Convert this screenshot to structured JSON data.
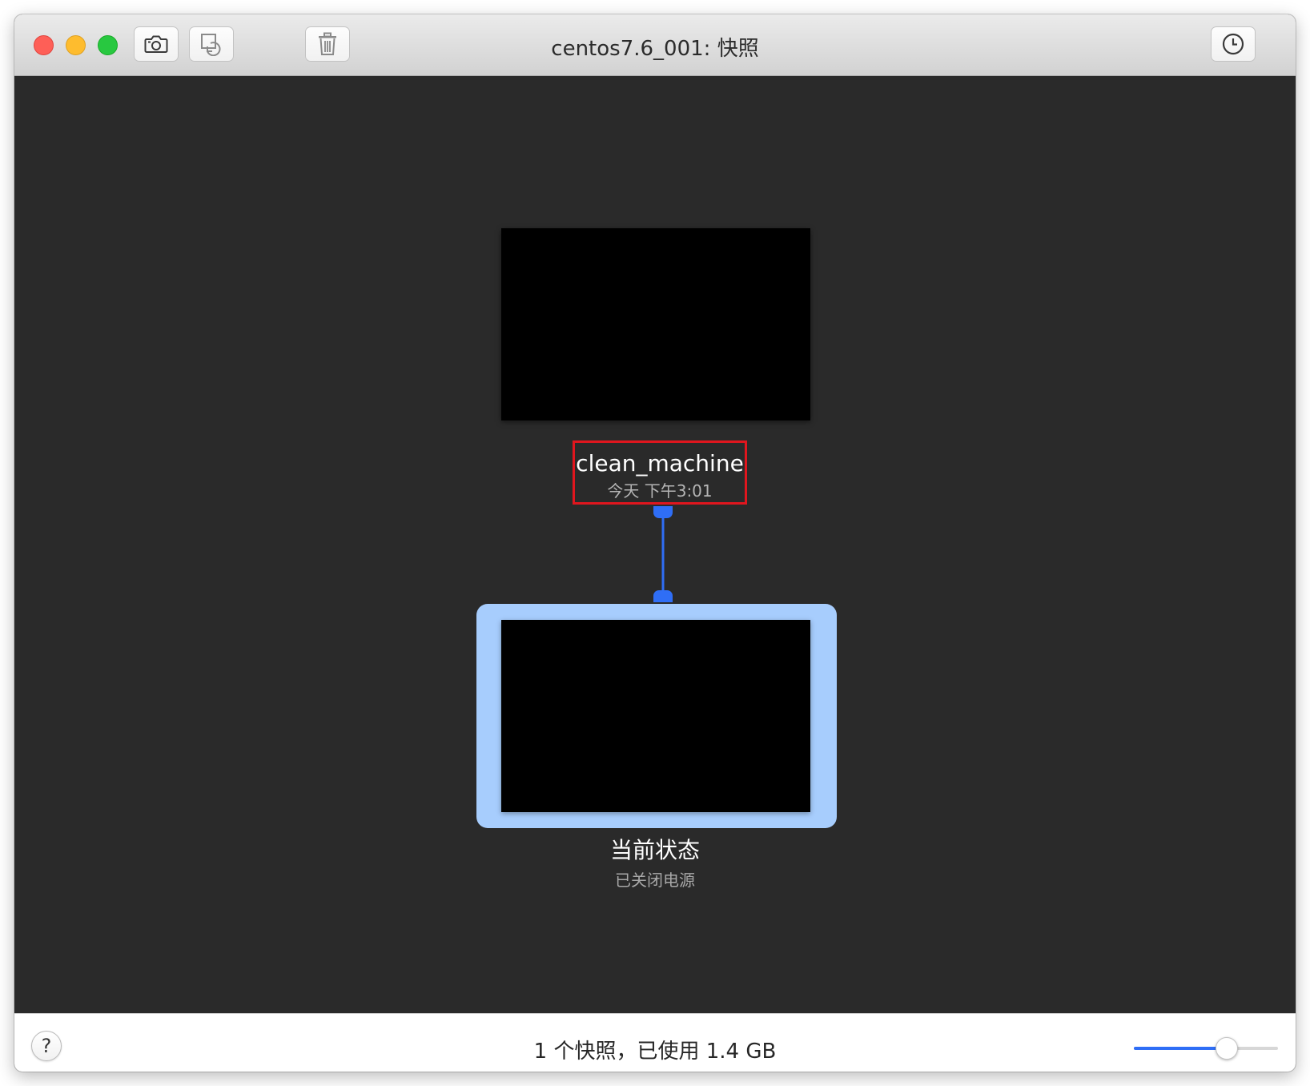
{
  "window": {
    "title": "centos7.6_001: 快照"
  },
  "toolbar": {
    "take_snapshot_icon": "camera-icon",
    "restore_snapshot_icon": "restore-icon",
    "delete_snapshot_icon": "trash-icon",
    "history_icon": "clock-icon"
  },
  "snapshot": {
    "name": "clean_machine",
    "time": "今天 下午3:01"
  },
  "current_state": {
    "name": "当前状态",
    "status": "已关闭电源"
  },
  "footer": {
    "help_label": "?",
    "summary": "1 个快照，已使用 1.4 GB",
    "zoom_fraction": 0.67
  },
  "colors": {
    "accent": "#2f6ef6",
    "selection": "#a7cdfd",
    "highlight_box": "#e0161e",
    "canvas": "#2a2a2a"
  }
}
